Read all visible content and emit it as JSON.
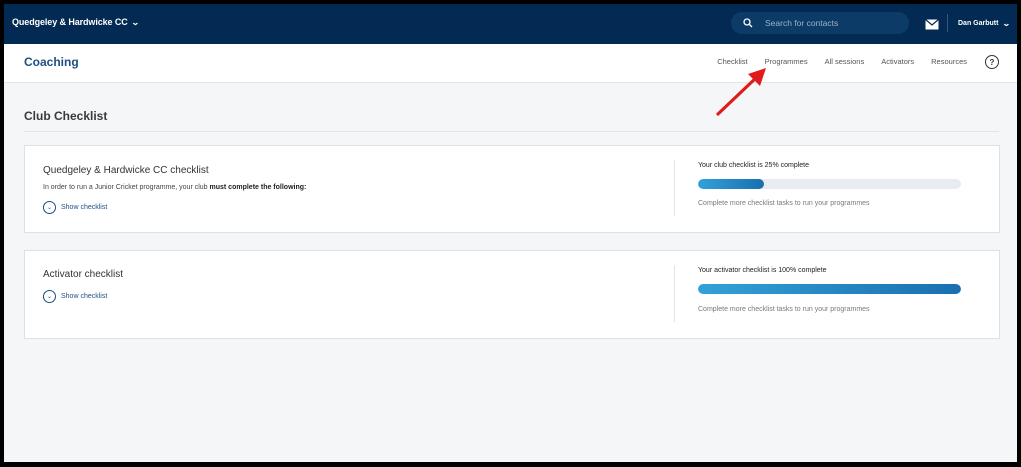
{
  "topbar": {
    "org_name": "Quedgeley & Hardwicke CC",
    "search_placeholder": "Search for contacts",
    "user_name": "Dan Garbutt"
  },
  "subnav": {
    "title": "Coaching",
    "links": [
      "Checklist",
      "Programmes",
      "All sessions",
      "Activators",
      "Resources"
    ],
    "help_label": "?"
  },
  "page": {
    "title": "Club Checklist"
  },
  "club_card": {
    "title": "Quedgeley & Hardwicke CC checklist",
    "desc_prefix": "In order to run a Junior Cricket programme, your club ",
    "desc_emphasis": "must complete the following:",
    "show_label": "Show checklist",
    "progress_label": "Your club checklist is 25% complete",
    "progress_percent": 25,
    "hint": "Complete more checklist tasks to run your programmes"
  },
  "activator_card": {
    "title": "Activator checklist",
    "show_label": "Show checklist",
    "progress_label": "Your activator checklist is 100% complete",
    "progress_percent": 100,
    "hint": "Complete more checklist tasks to run your programmes"
  },
  "colors": {
    "topbar": "#032a52",
    "brand_blue": "#1d4f82",
    "progress": "#2a8fd0",
    "annotation_arrow": "#e01b1b"
  }
}
